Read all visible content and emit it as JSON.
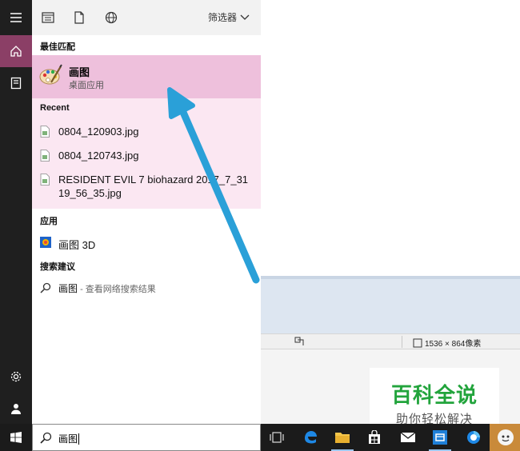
{
  "panel": {
    "filter_label": "筛选器",
    "best_match_heading": "最佳匹配",
    "best_match": {
      "name": "画图",
      "subtitle": "桌面应用"
    },
    "recent_heading": "Recent",
    "recent_items": [
      "0804_120903.jpg",
      "0804_120743.jpg",
      "RESIDENT EVIL 7 biohazard 2017_7_31",
      "19_56_35.jpg"
    ],
    "apps_heading": "应用",
    "app_item": "画图 3D",
    "suggest_heading": "搜索建议",
    "suggest_term": "画图",
    "suggest_hint": " - 查看网络搜索结果"
  },
  "search": {
    "value": "画图"
  },
  "background_app": {
    "dimensions": "1536 × 864像素"
  },
  "watermark": {
    "title": "百科全说",
    "subtitle": "助你轻松解决"
  },
  "colors": {
    "rail": "#1f1f1f",
    "rail_active": "#8b3f66",
    "best_match_bg": "#eec0dc",
    "recent_bg": "#fbe7f2",
    "arrow": "#2aa0d8",
    "watermark_green": "#22a43c"
  },
  "icons": {
    "rail": [
      "hamburger-icon",
      "home-icon",
      "document-icon",
      "gear-icon",
      "user-icon"
    ],
    "toolbar": [
      "apps-icon",
      "document-icon",
      "globe-icon",
      "chevron-down-icon"
    ],
    "taskbar": [
      "windows-icon",
      "search-icon",
      "task-view-icon",
      "edge-icon",
      "file-explorer-icon",
      "store-icon",
      "mail-icon",
      "paint-3d-icon",
      "app-icon",
      "avatar-icon"
    ]
  }
}
